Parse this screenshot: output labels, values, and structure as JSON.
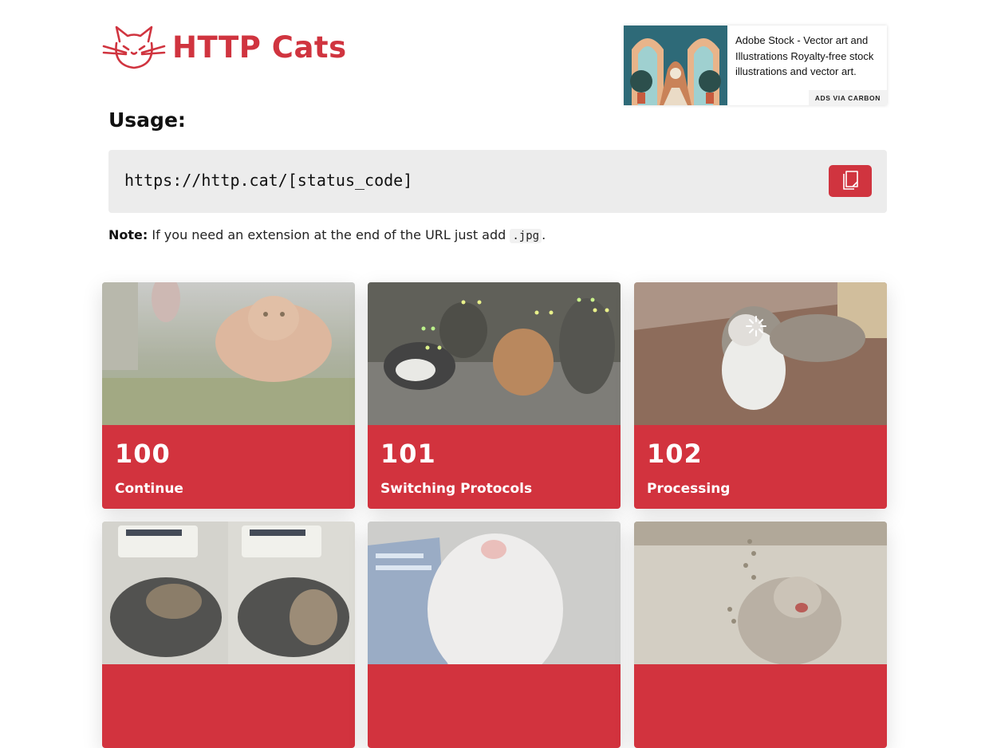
{
  "header": {
    "logo_text": "HTTP Cats",
    "logo_icon": "cat-logo-icon"
  },
  "ad": {
    "text": "Adobe Stock - Vector art and Illustrations Royalty-free stock illustrations and vector art.",
    "via_label": "ADS VIA CARBON"
  },
  "usage": {
    "title": "Usage:",
    "url": "https://http.cat/[status_code]",
    "copy_icon": "copy-icon"
  },
  "note": {
    "label": "Note:",
    "text": " If you need an extension at the end of the URL just add ",
    "code": ".jpg",
    "suffix": "."
  },
  "cards": [
    {
      "code": "100",
      "description": "Continue"
    },
    {
      "code": "101",
      "description": "Switching Protocols"
    },
    {
      "code": "102",
      "description": "Processing"
    },
    {
      "code": "",
      "description": ""
    },
    {
      "code": "",
      "description": ""
    },
    {
      "code": "",
      "description": ""
    }
  ],
  "colors": {
    "brand": "#d0343f",
    "card_footer": "#d2333e",
    "code_bg": "#ececec"
  }
}
